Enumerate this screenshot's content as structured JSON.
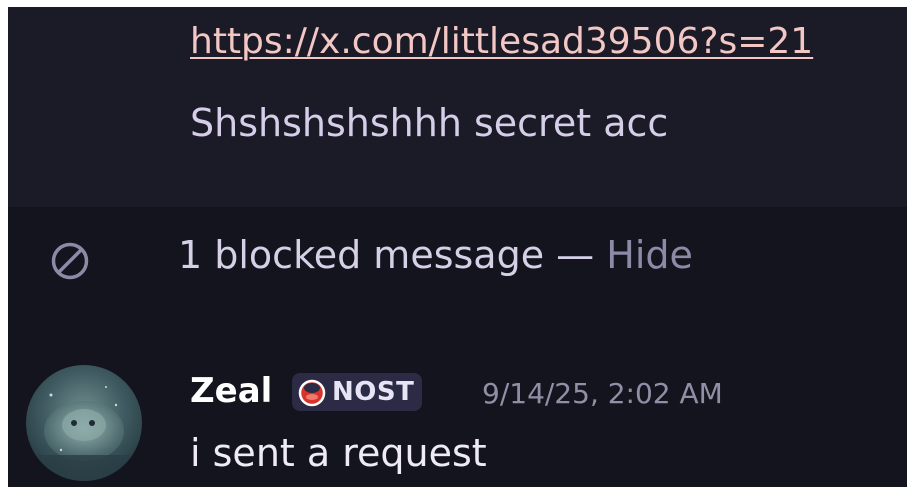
{
  "previous_message": {
    "link_text": "https://x.com/littlesad39506?s=21",
    "text": "Shshshshshhh secret acc"
  },
  "blocked_notice": {
    "icon": "blocked-icon",
    "text": "1 blocked message — ",
    "hide_label": "Hide"
  },
  "message": {
    "author": "Zeal",
    "tag": {
      "icon": "red-crescent-icon",
      "label": "NOST"
    },
    "timestamp": "9/14/25, 2:02 AM",
    "content": "i sent a request"
  },
  "colors": {
    "background": "#14141f",
    "link": "#f2c7c4",
    "muted": "#8f89a8",
    "tag_bg": "#2c2b45",
    "tag_icon": "#d8342c"
  }
}
